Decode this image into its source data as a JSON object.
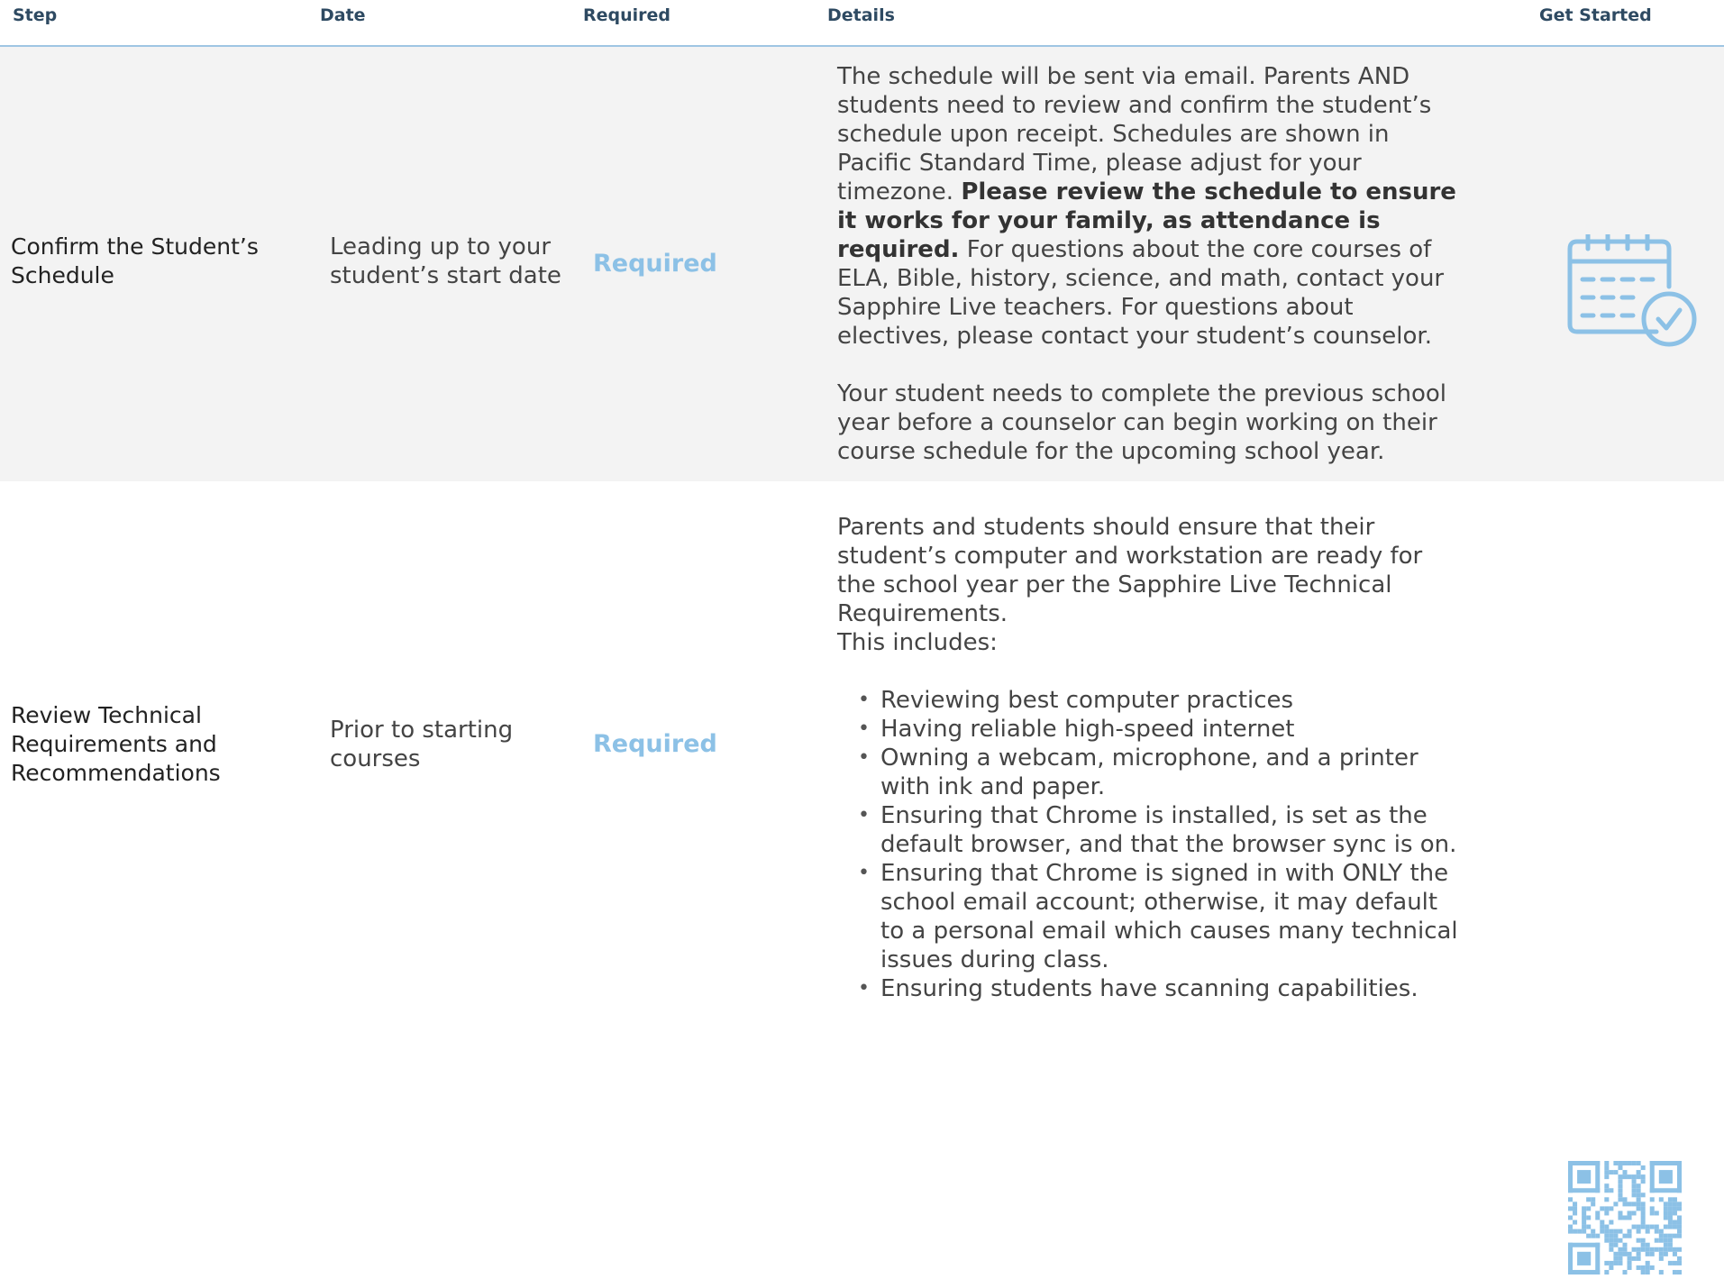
{
  "headers": {
    "step": "Step",
    "date": "Date",
    "required": "Required",
    "details": "Details",
    "get_started": "Get Started"
  },
  "rows": [
    {
      "step": "Confirm the Student’s Schedule",
      "date": "Leading up to your student’s start date",
      "required": "Required",
      "details": {
        "p1_start": "The schedule will be sent via email. Parents AND students need to review and confirm the student’s schedule upon receipt. Schedules are shown in Pacific Standard Time, please adjust for your timezone. ",
        "p1_bold": "Please review the schedule to ensure it works for your family, as attendance is required.",
        "p1_end": " For questions about the core courses of ELA, Bible, history, science, and math, contact your Sapphire Live teachers. For questions about electives, please contact your student’s counselor.",
        "p2": "Your student needs to complete the previous school year before a counselor can begin working on their course schedule for the upcoming school year."
      },
      "icon": "calendar-check-icon"
    },
    {
      "step": "Review Technical Requirements and Recommendations",
      "date": "Prior to starting courses",
      "required": "Required",
      "details": {
        "intro": "Parents and students should ensure that their student’s computer and workstation are ready for the school year per the Sapphire Live Technical Requirements.",
        "includes": "This includes:",
        "bullets": [
          "Reviewing best computer practices",
          "Having reliable high-speed internet",
          "Owning a webcam, microphone, and a printer with ink and paper.",
          "Ensuring that Chrome is installed, is set as the default browser, and that the browser sync is on.",
          "Ensuring that Chrome is signed in with ONLY the school email account; otherwise, it may default to a personal email which causes many technical issues during class.",
          "Ensuring students have scanning capabilities."
        ]
      },
      "icon": "qr-code-icon"
    }
  ],
  "colors": {
    "accent": "#8cc1e6",
    "header_text": "#2e4a62",
    "header_rule": "#9ec5e3",
    "row_alt": "#f3f3f3"
  }
}
